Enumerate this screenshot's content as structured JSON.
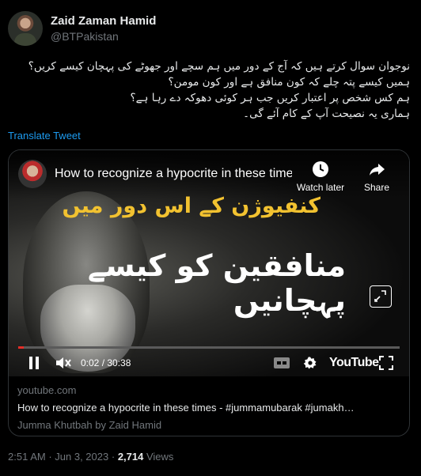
{
  "author": {
    "name": "Zaid Zaman Hamid",
    "handle": "@BTPakistan"
  },
  "tweet": {
    "lines": [
      "نوجوان سوال کرتے ہیں کہ آج کے دور میں ہم سچے اور جھوٹے کی پہچان کیسے کریں؟",
      "ہمیں کیسے پتہ چلے کہ کون منافق ہے اور کون مومن؟",
      "ہم کس شخص پر اعتبار کریں جب ہر کوئی دھوکہ دے رہا ہے؟",
      "ہماری یہ نصیحت آپ کے کام آئے گی۔"
    ],
    "translate_label": "Translate Tweet"
  },
  "video": {
    "title": "How to recognize a hypocrite in these times - #jummamubarak #jumakh...",
    "watch_later": "Watch later",
    "share": "Share",
    "overlay_line1": "کنفیوژن کے اس دور میں",
    "overlay_line2": "منافقین کو کیسے پہچانیں",
    "time": "0:02 / 30:38",
    "progress": 0.01,
    "brand": "YouTube"
  },
  "card": {
    "domain": "youtube.com",
    "title": "How to recognize a hypocrite in these times - #jummamubarak #jumakh…",
    "description": "Jumma Khutbah by Zaid Hamid"
  },
  "meta": {
    "time": "2:51 AM",
    "date": "Jun 3, 2023",
    "views_count": "2,714",
    "views_label": "Views"
  },
  "colors": {
    "link": "#1d9bf0",
    "accent_gold": "#f2c230",
    "progress_red": "#e52d27"
  }
}
